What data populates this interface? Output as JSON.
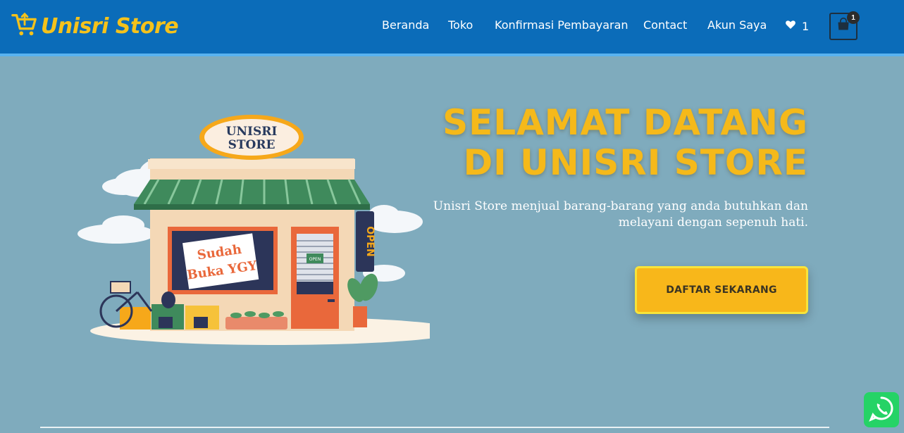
{
  "header": {
    "brand": "Unisri Store",
    "nav": [
      "Beranda",
      "Toko",
      "Konfirmasi Pembayaran",
      "Contact",
      "Akun Saya"
    ],
    "wishlist_count": "1",
    "cart_count": "1"
  },
  "hero": {
    "title_line1": "SELAMAT DATANG",
    "title_line2": "DI UNISRI STORE",
    "subtitle_line1": "Unisri Store menjual barang-barang yang anda butuhkan dan",
    "subtitle_line2": "melayani dengan sepenuh hati.",
    "cta_label": "DAFTAR SEKARANG"
  },
  "illustration": {
    "sign_line1": "UNISRI",
    "sign_line2": "STORE",
    "window_line1": "Sudah",
    "window_line2": "Buka YGY",
    "door_sign": "OPEN",
    "side_sign": "OPEN"
  },
  "colors": {
    "header_bg": "#0b6cb9",
    "page_bg": "#7fabbd",
    "accent_yellow": "#f5b91a",
    "whatsapp": "#25d366"
  },
  "icons": [
    "cart-logo-icon",
    "heart-icon",
    "shopping-bag-icon",
    "whatsapp-icon"
  ]
}
